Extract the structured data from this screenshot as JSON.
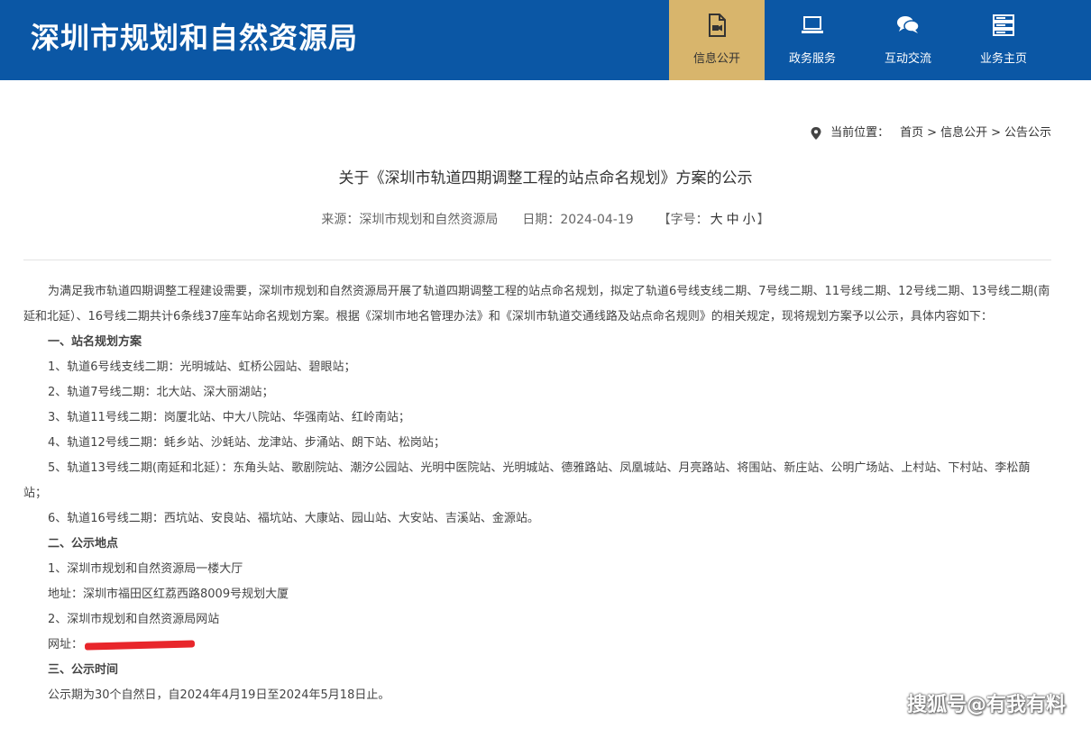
{
  "header": {
    "site_title": "深圳市规划和自然资源局",
    "nav": [
      {
        "label": "信息公开",
        "icon": "info-video-icon",
        "active": true
      },
      {
        "label": "政务服务",
        "icon": "laptop-icon",
        "active": false
      },
      {
        "label": "互动交流",
        "icon": "chat-bubbles-icon",
        "active": false
      },
      {
        "label": "业务主页",
        "icon": "server-stack-icon",
        "active": false
      }
    ],
    "colors": {
      "bar": "#0b57a5",
      "active": "#d8b56c"
    }
  },
  "breadcrumb": {
    "prefix": "当前位置：",
    "items": [
      "首页",
      "信息公开",
      "公告公示"
    ],
    "separator": ">"
  },
  "article": {
    "title": "关于《深圳市轨道四期调整工程的站点命名规划》方案的公示",
    "meta": {
      "source_label": "来源：",
      "source": "深圳市规划和自然资源局",
      "date_label": "日期：",
      "date": "2024-04-19",
      "font_size_label": "【字号：",
      "font_sizes": [
        "大",
        "中",
        "小"
      ],
      "font_size_close": "】"
    },
    "intro": "为满足我市轨道四期调整工程建设需要，深圳市规划和自然资源局开展了轨道四期调整工程的站点命名规划，拟定了轨道6号线支线二期、7号线二期、11号线二期、12号线二期、13号线二期(南延和北延）、16号线二期共计6条线37座车站命名规划方案。根据《深圳市地名管理办法》和《深圳市轨道交通线路及站点命名规则》的相关规定，现将规划方案予以公示，具体内容如下：",
    "section1_title": "一、站名规划方案",
    "lines": [
      "1、轨道6号线支线二期：光明城站、虹桥公园站、碧眼站；",
      "2、轨道7号线二期：北大站、深大丽湖站；",
      "3、轨道11号线二期：岗厦北站、中大八院站、华强南站、红岭南站；",
      "4、轨道12号线二期：蚝乡站、沙蚝站、龙津站、步涌站、朗下站、松岗站；",
      "5、轨道13号线二期(南延和北延）：东角头站、歌剧院站、潮汐公园站、光明中医院站、光明城站、德雅路站、凤凰城站、月亮路站、将围站、新庄站、公明广场站、上村站、下村站、李松蓢站；",
      "6、轨道16号线二期：西坑站、安良站、福坑站、大康站、园山站、大安站、吉溪站、金源站。"
    ],
    "section2_title": "二、公示地点",
    "place1": "1、深圳市规划和自然资源局一楼大厅",
    "address": "地址：深圳市福田区红荔西路8009号规划大厦",
    "place2": "2、深圳市规划和自然资源局网站",
    "url_label": "网址：",
    "section3_title": "三、公示时间",
    "period": "公示期为30个自然日，自2024年4月19日至2024年5月18日止。"
  },
  "watermark": "搜狐号@有我有料"
}
